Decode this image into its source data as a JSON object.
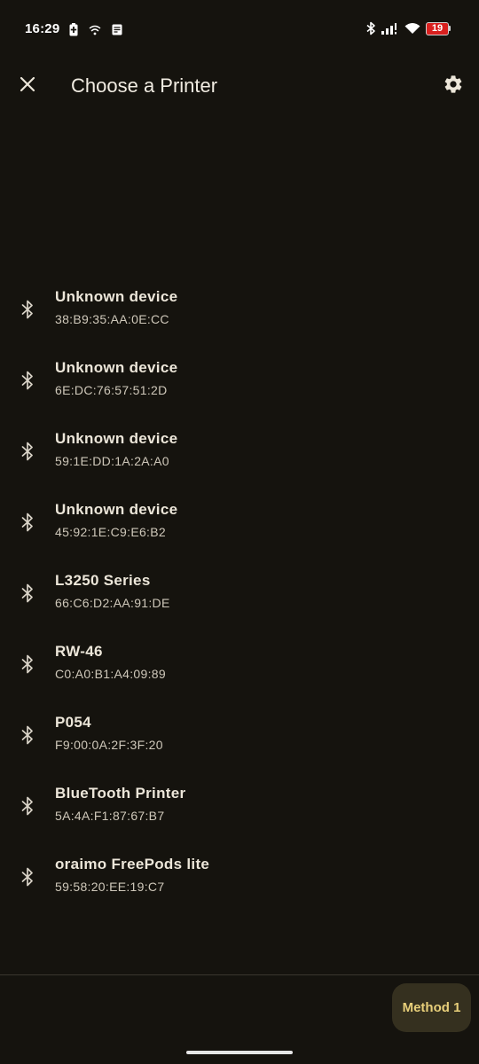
{
  "status_bar": {
    "time": "16:29",
    "battery_level": "19",
    "icons_left": [
      "battery-saver-icon",
      "cast-icon",
      "notes-icon"
    ],
    "icons_right": [
      "bluetooth-icon",
      "signal-icon",
      "wifi-icon",
      "battery-icon"
    ]
  },
  "app_bar": {
    "title": "Choose a Printer",
    "close_icon": "close-icon",
    "settings_icon": "gear-icon"
  },
  "devices": [
    {
      "name": "Unknown device",
      "mac": "38:B9:35:AA:0E:CC",
      "icon": "bluetooth-icon"
    },
    {
      "name": "Unknown device",
      "mac": "6E:DC:76:57:51:2D",
      "icon": "bluetooth-icon"
    },
    {
      "name": "Unknown device",
      "mac": "59:1E:DD:1A:2A:A0",
      "icon": "bluetooth-icon"
    },
    {
      "name": "Unknown device",
      "mac": "45:92:1E:C9:E6:B2",
      "icon": "bluetooth-icon"
    },
    {
      "name": "L3250 Series",
      "mac": "66:C6:D2:AA:91:DE",
      "icon": "bluetooth-icon"
    },
    {
      "name": "RW-46",
      "mac": "C0:A0:B1:A4:09:89",
      "icon": "bluetooth-icon"
    },
    {
      "name": "P054",
      "mac": "F9:00:0A:2F:3F:20",
      "icon": "bluetooth-icon"
    },
    {
      "name": "BlueTooth Printer",
      "mac": "5A:4A:F1:87:67:B7",
      "icon": "bluetooth-icon"
    },
    {
      "name": "oraimo FreePods lite",
      "mac": "59:58:20:EE:19:C7",
      "icon": "bluetooth-icon"
    }
  ],
  "bottom": {
    "method_button_label": "Method 1"
  },
  "colors": {
    "background": "#15130e",
    "accent": "#e8cf7a",
    "button_bg": "#35301f",
    "battery_low": "#d9201f"
  }
}
